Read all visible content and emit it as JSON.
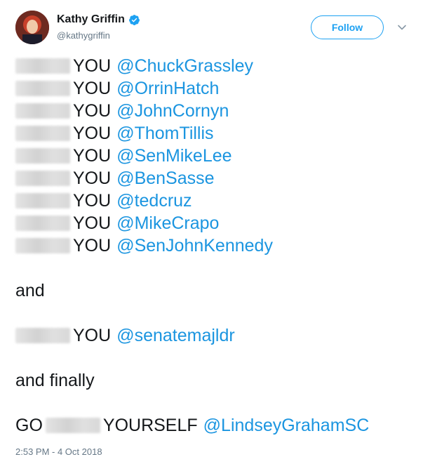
{
  "author": {
    "display_name": "Kathy Griffin",
    "handle": "@kathygriffin"
  },
  "follow_label": "Follow",
  "tweet": {
    "lines": [
      {
        "censored": "FUCK",
        "word": "YOU",
        "mention": "@ChuckGrassley"
      },
      {
        "censored": "FUCK",
        "word": "YOU",
        "mention": "@OrrinHatch"
      },
      {
        "censored": "FUCK",
        "word": "YOU",
        "mention": "@JohnCornyn"
      },
      {
        "censored": "FUCK",
        "word": "YOU",
        "mention": "@ThomTillis"
      },
      {
        "censored": "FUCK",
        "word": "YOU",
        "mention": "@SenMikeLee"
      },
      {
        "censored": "FUCK",
        "word": "YOU",
        "mention": "@BenSasse"
      },
      {
        "censored": "FUCK",
        "word": "YOU",
        "mention": "@tedcruz"
      },
      {
        "censored": "FUCK",
        "word": "YOU",
        "mention": "@MikeCrapo"
      },
      {
        "censored": "FUCK",
        "word": "YOU",
        "mention": "@SenJohnKennedy"
      }
    ],
    "and_text": "and",
    "mcconnell_line": {
      "censored": "FUCK",
      "word": "YOU",
      "mention": "@senatemajldr"
    },
    "finally_text": "and finally",
    "final_line": {
      "go": "GO",
      "censored": "FUCK",
      "yourself": "YOURSELF",
      "mention": "@LindseyGrahamSC"
    }
  },
  "timestamp": "2:53 PM - 4 Oct 2018",
  "colors": {
    "link": "#1b95e0",
    "follow": "#1da1f2",
    "verified": "#1da1f2",
    "muted": "#657786"
  },
  "icons": {
    "verified": "verified-badge-icon",
    "caret": "chevron-down-icon"
  }
}
